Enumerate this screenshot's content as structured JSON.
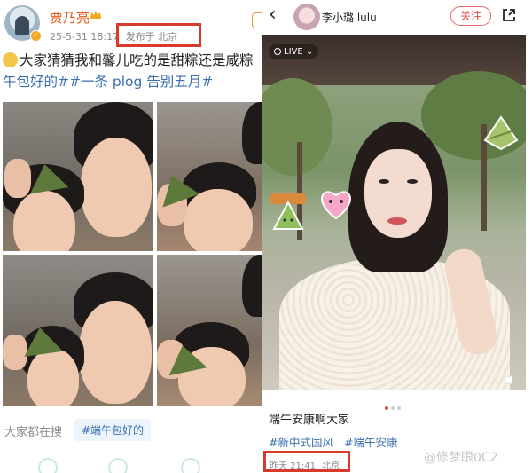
{
  "left_post": {
    "author_name": "贾乃亮",
    "date": "25-5-31 18:17",
    "location_label": "发布于 北京",
    "text_line1": "大家猜猜我和馨儿吃的是甜粽还是咸粽",
    "text_line2": "午包好的##一条 plog 告别五月#",
    "search_label": "大家都在搜",
    "search_tag": "#端午包好的"
  },
  "right_post": {
    "back_icon": "‹",
    "author_name": "李小璐 lulu",
    "follow_label": "关注",
    "live_label": "LIVE",
    "title": "端午安康啊大家",
    "tags": [
      "#新中式国风",
      "#端午安康"
    ],
    "time": "昨天 21:41",
    "location": "北京",
    "watermark": "@修梦眼0C2"
  },
  "colors": {
    "highlight_box": "#d83a2c",
    "link_blue": "#3a6fb0",
    "author_orange": "#e3570f",
    "follow_red": "#e3463f"
  }
}
